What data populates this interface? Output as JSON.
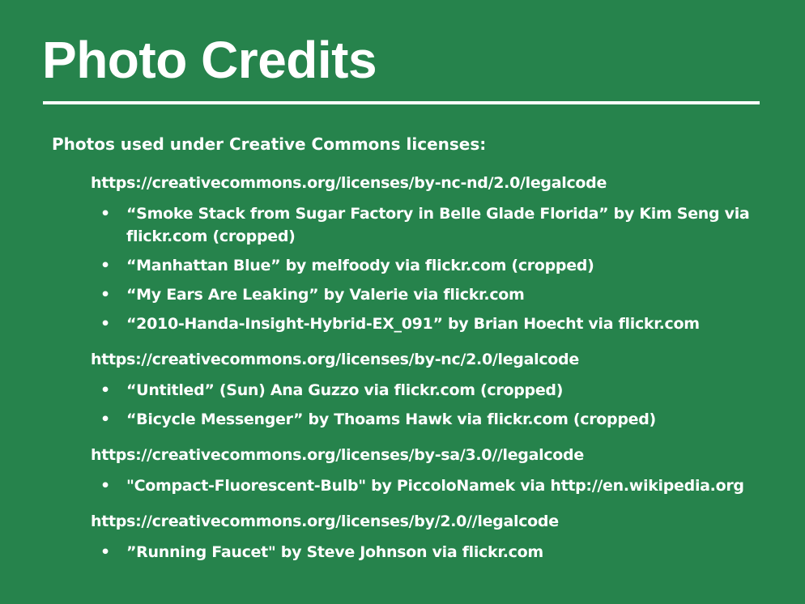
{
  "title": "Photo Credits",
  "intro": "Photos used under Creative Commons licenses:",
  "license_groups": [
    {
      "license": "https://creativecommons.org/licenses/by-nc-nd/2.0/legalcode",
      "credits": [
        "“Smoke Stack from Sugar Factory in Belle Glade Florida” by Kim Seng via flickr.com (cropped)",
        "“Manhattan Blue” by melfoody via flickr.com (cropped)",
        "“My Ears Are Leaking” by Valerie via flickr.com",
        "“2010-Handa-Insight-Hybrid-EX_091” by Brian Hoecht via flickr.com"
      ]
    },
    {
      "license": "https://creativecommons.org/licenses/by-nc/2.0/legalcode",
      "credits": [
        "“Untitled” (Sun) Ana Guzzo via flickr.com (cropped)",
        "“Bicycle Messenger” by Thoams Hawk via flickr.com (cropped)"
      ]
    },
    {
      "license": "https://creativecommons.org/licenses/by-sa/3.0//legalcode",
      "credits": [
        "\"Compact-Fluorescent-Bulb\" by PiccoloNamek via http://en.wikipedia.org"
      ]
    },
    {
      "license": "https://creativecommons.org/licenses/by/2.0//legalcode",
      "credits": [
        "”Running Faucet\" by Steve Johnson via flickr.com"
      ]
    }
  ],
  "bullet_glyph": "•",
  "colors": {
    "background": "#26834c",
    "text": "#ffffff"
  }
}
